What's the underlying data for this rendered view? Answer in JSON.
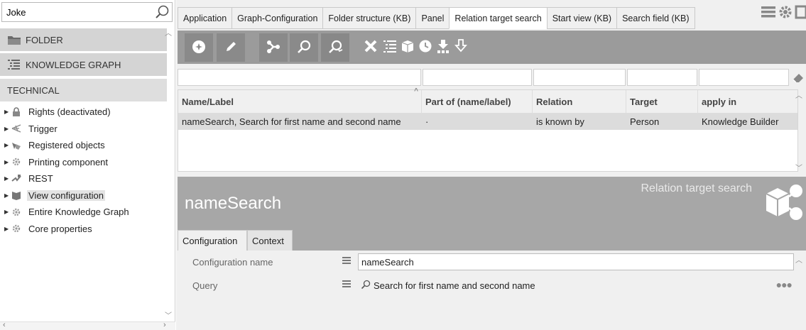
{
  "search": {
    "value": "Joke"
  },
  "categories": [
    {
      "label": "FOLDER",
      "icon": "folder-icon"
    },
    {
      "label": "KNOWLEDGE GRAPH",
      "icon": "hierarchy-list-icon"
    },
    {
      "label": "TECHNICAL",
      "icon": ""
    }
  ],
  "tree": [
    {
      "label": "Rights (deactivated)",
      "icon": "lock-icon"
    },
    {
      "label": "Trigger",
      "icon": "trigger-icon"
    },
    {
      "label": "Registered objects",
      "icon": "registered-objects-icon"
    },
    {
      "label": "Printing component",
      "icon": "gear-icon"
    },
    {
      "label": "REST",
      "icon": "rest-icon"
    },
    {
      "label": "View configuration",
      "icon": "view-config-icon"
    },
    {
      "label": "Entire Knowledge Graph",
      "icon": "gear-icon"
    },
    {
      "label": "Core properties",
      "icon": "gear-icon"
    }
  ],
  "tabs": [
    {
      "label": "Application"
    },
    {
      "label": "Graph-Configuration"
    },
    {
      "label": "Folder structure (KB)"
    },
    {
      "label": "Panel"
    },
    {
      "label": "Relation target search"
    },
    {
      "label": "Start view (KB)"
    },
    {
      "label": "Search field (KB)"
    }
  ],
  "grid": {
    "headers": [
      "Name/Label",
      "Part of (name/label)",
      "Relation",
      "Target",
      "apply in"
    ],
    "rows": [
      [
        "nameSearch, Search for first name and second name",
        "·",
        "is known by",
        "Person",
        "Knowledge Builder"
      ]
    ]
  },
  "detail": {
    "title": "nameSearch",
    "type": "Relation target search",
    "tabs": [
      "Configuration",
      "Context"
    ],
    "config_name_label": "Configuration name",
    "config_name_value": "nameSearch",
    "query_label": "Query",
    "query_value": "Search for first name and second name"
  },
  "colors": {
    "toolbar": "#9b9b9b",
    "header": "#a7a7a7",
    "selected_row": "#dcdcdc"
  }
}
